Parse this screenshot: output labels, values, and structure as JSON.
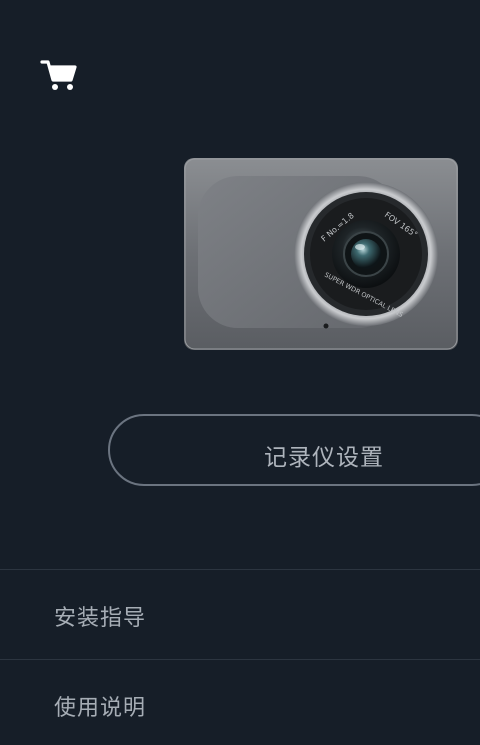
{
  "header": {
    "cart_icon": "shopping-cart-icon"
  },
  "device": {
    "image": "dashcam-image",
    "lens_text_top_left": "F No.=1.8",
    "lens_text_top_right": "FOV 165°",
    "lens_text_bottom": "SUPER WDR OPTICAL LENS"
  },
  "settings_button": {
    "label": "记录仪设置"
  },
  "menu": {
    "items": [
      {
        "label": "安装指导"
      },
      {
        "label": "使用说明"
      }
    ]
  },
  "colors": {
    "background": "#161e28",
    "button_border": "#6b7480",
    "text": "#aeb4bc",
    "divider": "#2c3540"
  }
}
